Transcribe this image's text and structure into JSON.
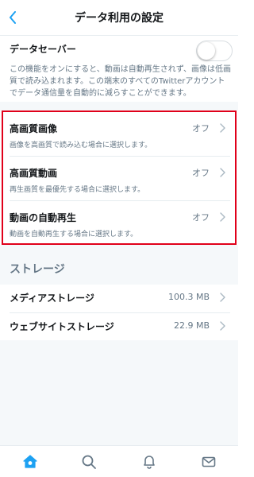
{
  "header": {
    "title": "データ利用の設定",
    "back_icon": "chevron-left-icon"
  },
  "data_saver": {
    "label": "データセーバー",
    "enabled": false,
    "description_lines": [
      "この機能をオンにすると、動画は自動再生されず、画像は低画",
      "質で読み込まれます。この端末のすべてのTwitterアカウント",
      "でデータ通信量を自動的に減らすことができます。"
    ]
  },
  "settings": [
    {
      "title": "高画質画像",
      "value": "オフ",
      "description": "画像を高画質で読み込む場合に選択します。"
    },
    {
      "title": "高画質動画",
      "value": "オフ",
      "description": "再生画質を最優先する場合に選択します。"
    },
    {
      "title": "動画の自動再生",
      "value": "オフ",
      "description": "動画を自動再生する場合に選択します。"
    }
  ],
  "storage": {
    "header": "ストレージ",
    "items": [
      {
        "label": "メディアストレージ",
        "value": "100.3 MB"
      },
      {
        "label": "ウェブサイトストレージ",
        "value": "22.9 MB"
      }
    ]
  },
  "tabbar": {
    "items": [
      "home-icon",
      "search-icon",
      "notifications-icon",
      "messages-icon"
    ],
    "active": "home-icon"
  },
  "colors": {
    "accent": "#1da1f2",
    "highlight_border": "#e0001a",
    "secondary_text": "#657786",
    "background_gray": "#f5f8fa"
  }
}
